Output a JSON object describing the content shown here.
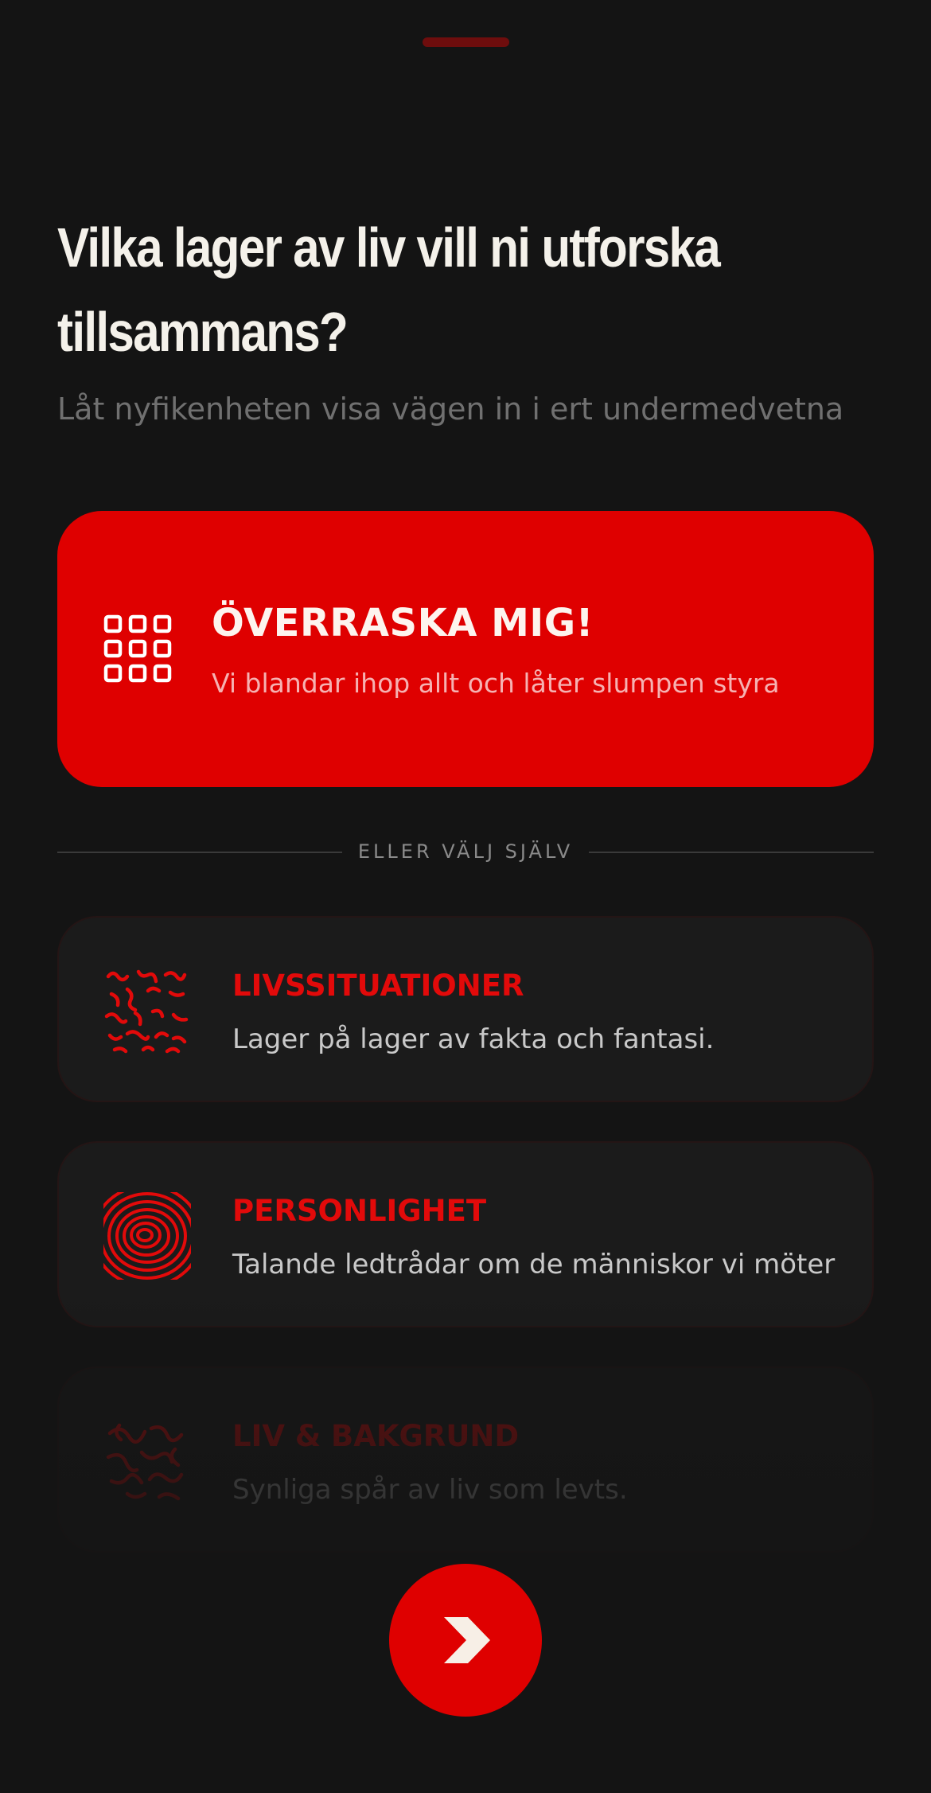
{
  "header": {
    "title_line1": "Vilka lager av liv vill ni utforska",
    "title_line2": "tillsammans?",
    "subtitle": "Låt nyfikenheten visa vägen in i ert undermedvetna"
  },
  "surprise": {
    "icon": "grid-icon",
    "title": "ÖVERRASKA MIG!",
    "description": "Vi blandar ihop allt och låter slumpen styra"
  },
  "divider": {
    "label": "ELLER VÄLJ SJÄLV"
  },
  "categories": [
    {
      "icon": "squiggle-pattern-icon",
      "title": "LIVSSITUATIONER",
      "description": "Lager på lager av fakta och fantasi."
    },
    {
      "icon": "contour-lines-icon",
      "title": "PERSONLIGHET",
      "description": "Talande ledtrådar om de människor vi möter"
    },
    {
      "icon": "vine-pattern-icon",
      "title": "LIV & BAKGRUND",
      "description": "Synliga spår av liv som levts."
    }
  ],
  "next_button": {
    "icon": "chevron-right-icon"
  },
  "colors": {
    "background": "#141414",
    "accent": "#df0000",
    "card": "#1b1b1b"
  }
}
